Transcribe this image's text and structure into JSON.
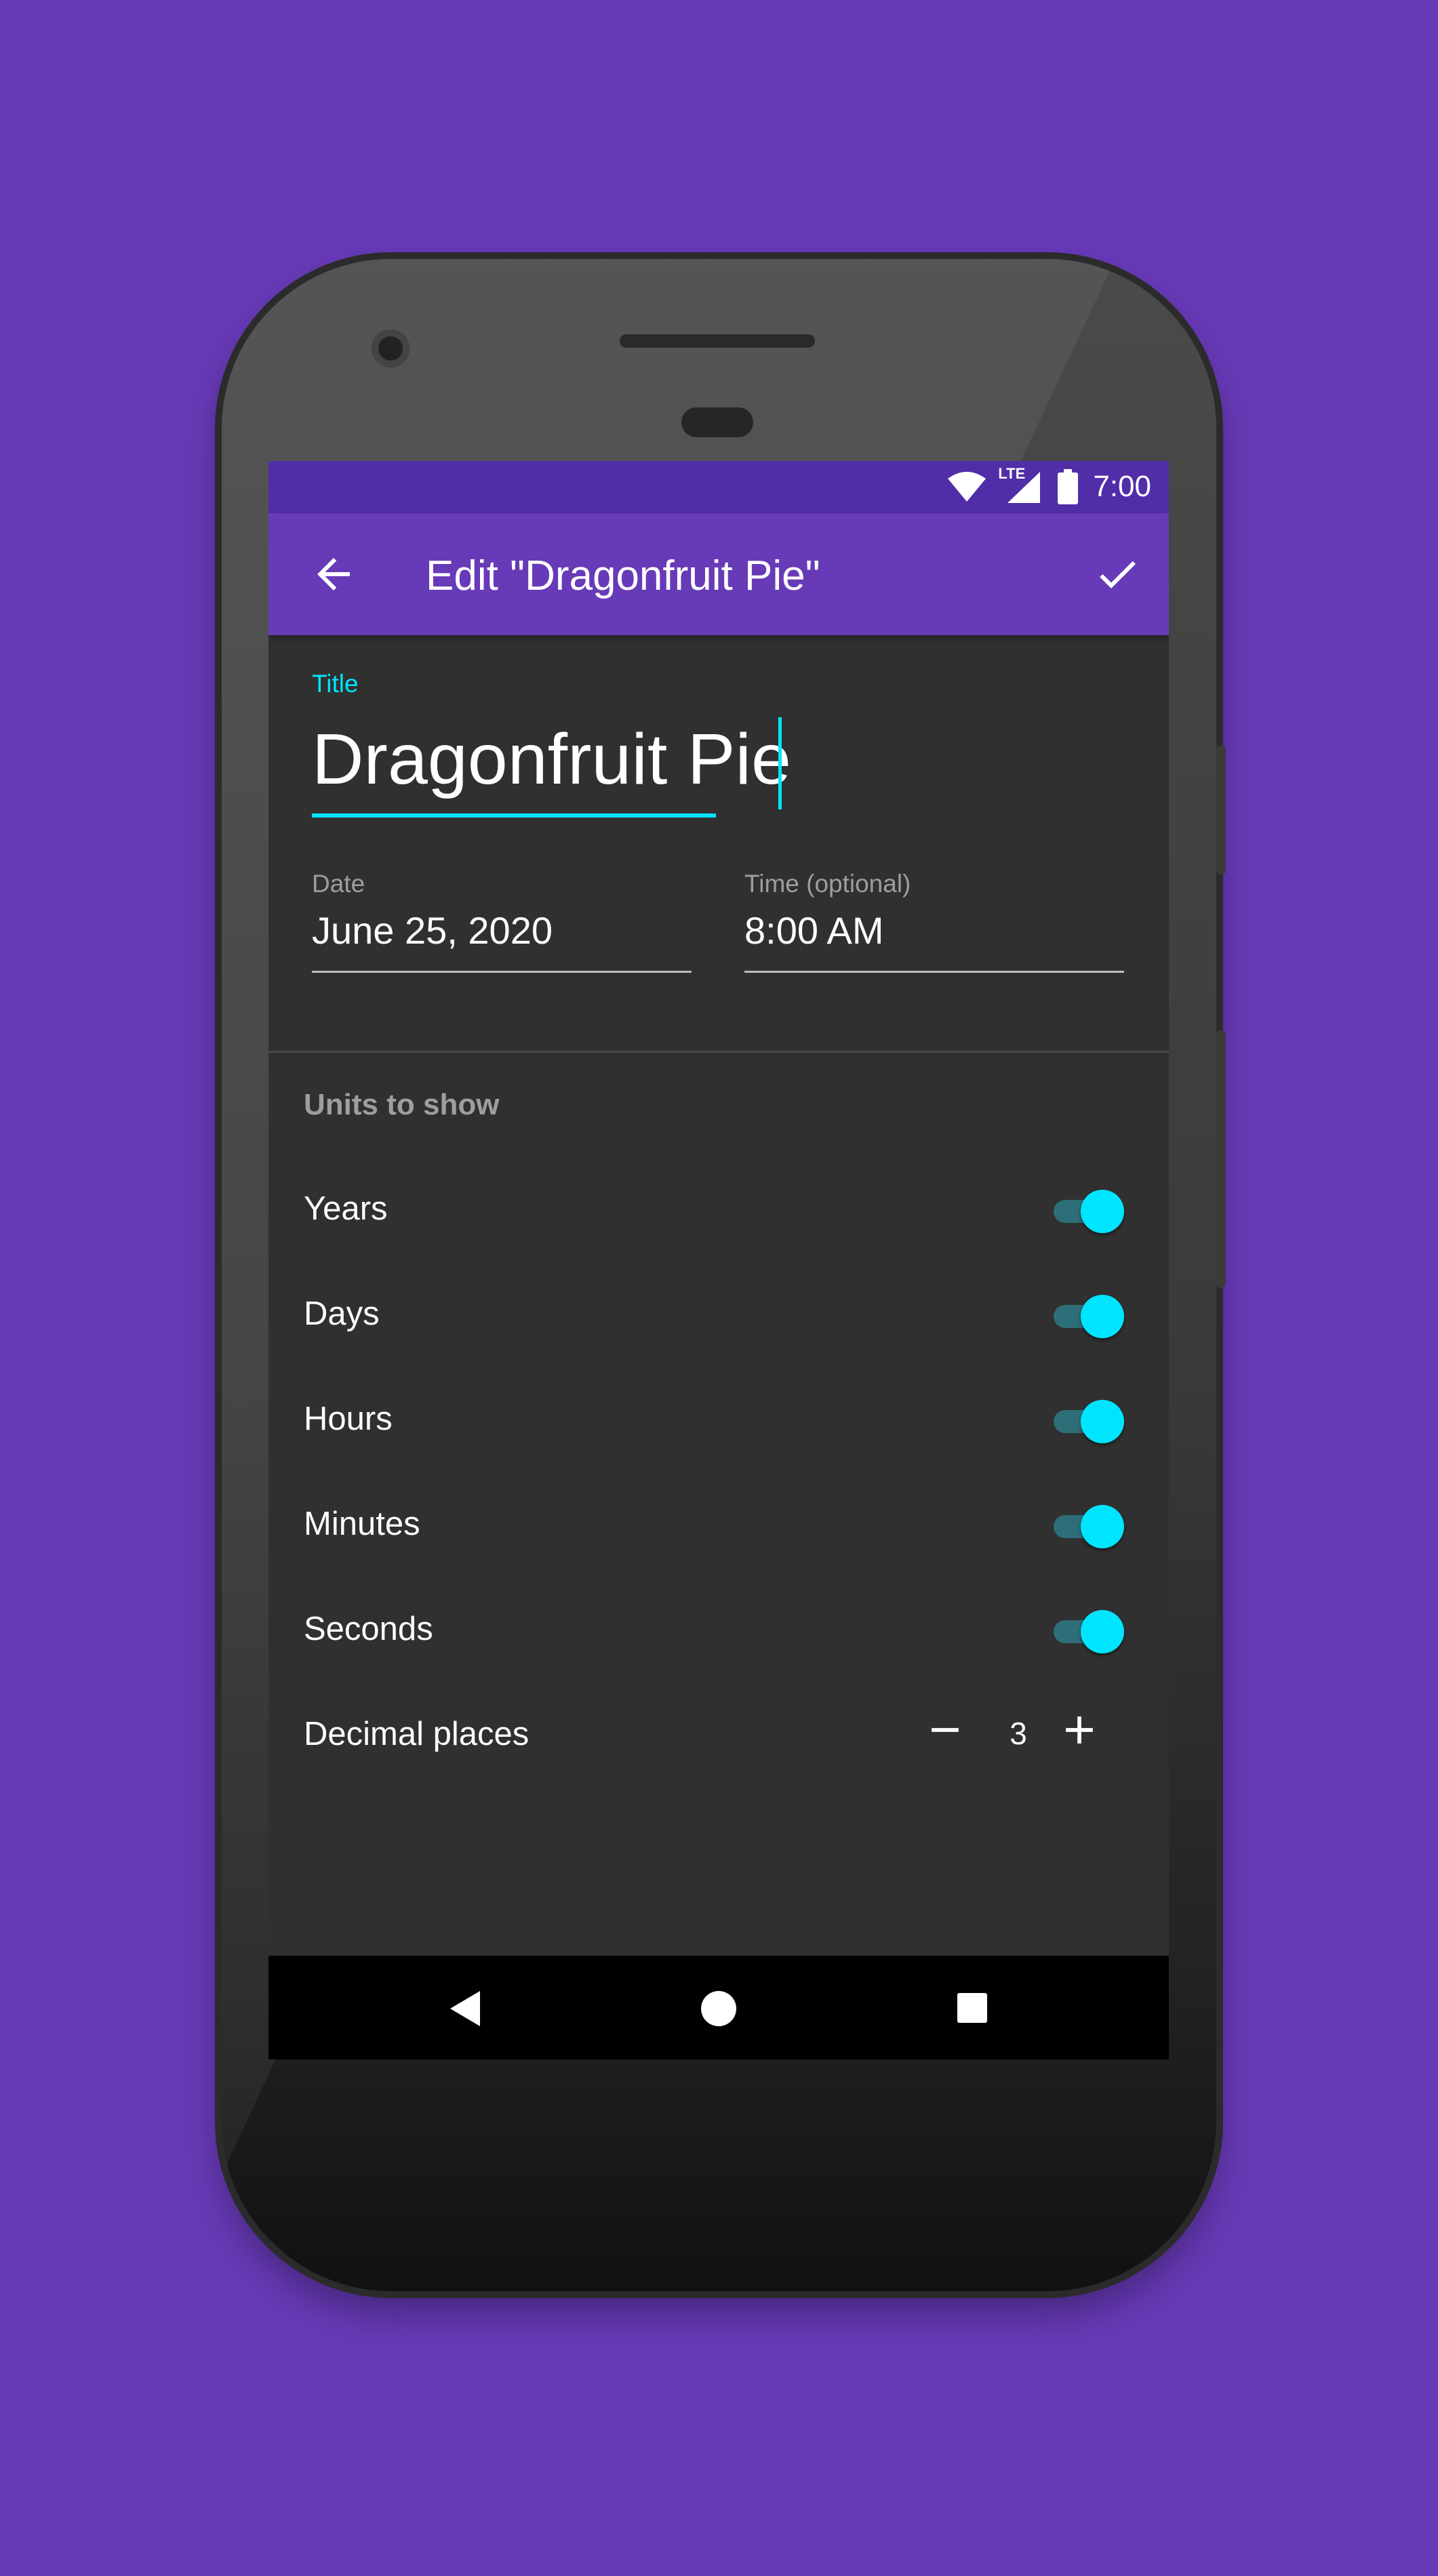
{
  "status_bar": {
    "network_label": "LTE",
    "time": "7:00",
    "icons": [
      "wifi-icon",
      "signal-icon",
      "battery-icon"
    ]
  },
  "toolbar": {
    "title": "Edit \"Dragonfruit Pie\"",
    "back_icon": "arrow-back-icon",
    "confirm_icon": "check-icon"
  },
  "form": {
    "title_label": "Title",
    "title_value": "Dragonfruit Pie",
    "date_label": "Date",
    "date_value": "June 25, 2020",
    "time_label": "Time (optional)",
    "time_value": "8:00 AM"
  },
  "units": {
    "heading": "Units to show",
    "items": [
      {
        "label": "Years",
        "enabled": true
      },
      {
        "label": "Days",
        "enabled": true
      },
      {
        "label": "Hours",
        "enabled": true
      },
      {
        "label": "Minutes",
        "enabled": true
      },
      {
        "label": "Seconds",
        "enabled": true
      }
    ]
  },
  "decimal": {
    "label": "Decimal places",
    "value": "3"
  },
  "colors": {
    "background": "#673AB7",
    "status_bar": "#512DA8",
    "toolbar": "#673AB7",
    "accent": "#00E5FF",
    "screen": "#303030"
  },
  "nav_bar": {
    "icons": [
      "back-triangle-icon",
      "home-circle-icon",
      "recents-square-icon"
    ]
  }
}
